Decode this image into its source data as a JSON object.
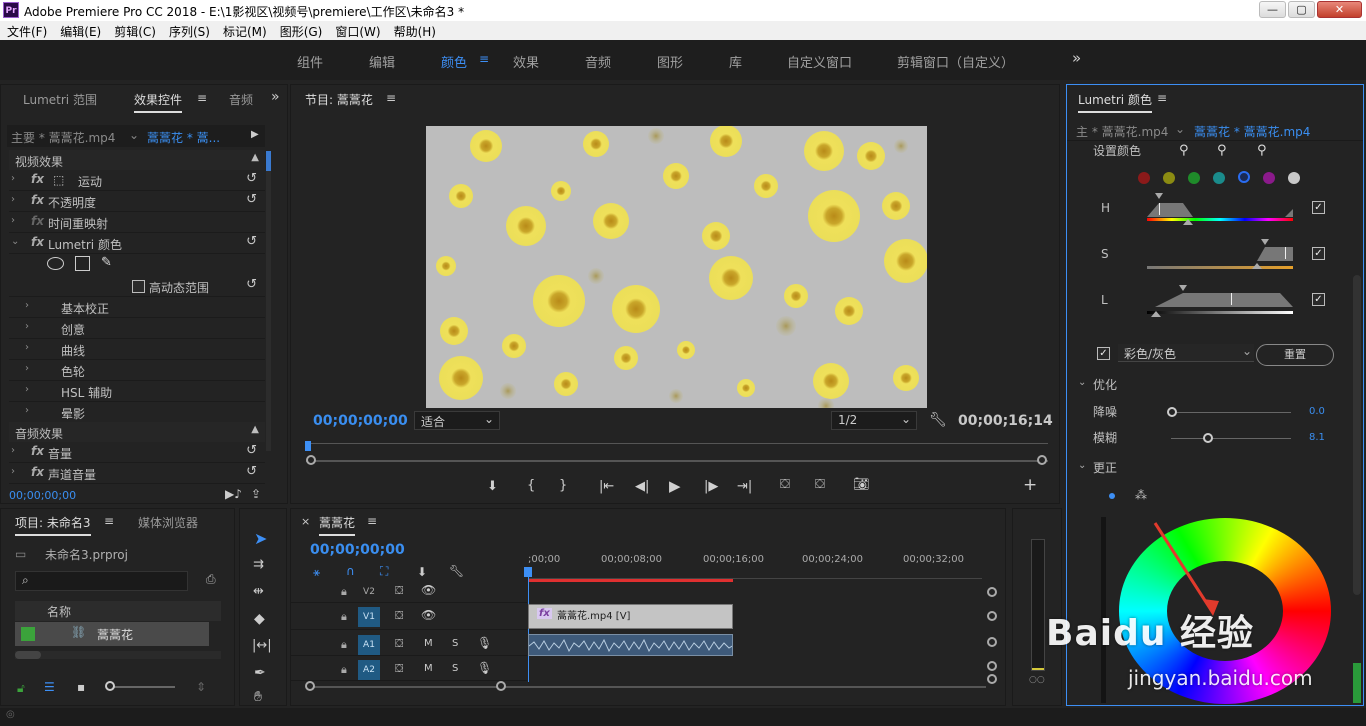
{
  "titlebar": {
    "logo": "Pr",
    "title": "Adobe Premiere Pro CC 2018 - E:\\1影视区\\视频号\\premiere\\工作区\\未命名3 *",
    "min": "—",
    "max": "▢",
    "close": "✕"
  },
  "menu": [
    "文件(F)",
    "编辑(E)",
    "剪辑(C)",
    "序列(S)",
    "标记(M)",
    "图形(G)",
    "窗口(W)",
    "帮助(H)"
  ],
  "workspaces": [
    "组件",
    "编辑",
    "颜色",
    "效果",
    "音频",
    "图形",
    "库",
    "自定义窗口",
    "剪辑窗口（自定义）"
  ],
  "workspace_active": "颜色",
  "workspace_more": "»",
  "effects_panel": {
    "tabs": [
      "Lumetri 范围",
      "效果控件",
      "音频"
    ],
    "active_tab": "效果控件",
    "master_clip": "主要 * 蒿蒿花.mp4",
    "seq_clip": "蒿蒿花 * 蒿...",
    "video_section": "视频效果",
    "effects": [
      "运动",
      "不透明度",
      "时间重映射",
      "Lumetri 颜色"
    ],
    "hdr_label": "高动态范围",
    "lumetri_sub": [
      "基本校正",
      "创意",
      "曲线",
      "色轮",
      "HSL 辅助",
      "晕影"
    ],
    "audio_section": "音频效果",
    "audio_effects": [
      "音量",
      "声道音量"
    ],
    "timecode": "00;00;00;00"
  },
  "program": {
    "title": "节目: 蒿蒿花",
    "timecode_left": "00;00;00;00",
    "fit": "适合",
    "resolution": "1/2",
    "timecode_right": "00;00;16;14"
  },
  "project": {
    "tabs": [
      "项目: 未命名3",
      "媒体浏览器"
    ],
    "file": "未命名3.prproj",
    "search_placeholder": "",
    "col_name": "名称",
    "item": "蒿蒿花"
  },
  "timeline": {
    "title": "蒿蒿花",
    "timecode": "00;00;00;00",
    "ruler": [
      ";00;00",
      "00;00;08;00",
      "00;00;16;00",
      "00;00;24;00",
      "00;00;32;00"
    ],
    "tracks": [
      "V2",
      "V1",
      "A1",
      "A2"
    ],
    "clip_label": "蒿蒿花.mp4 [V]",
    "m": "M",
    "s": "S"
  },
  "lumetri": {
    "title": "Lumetri 颜色",
    "master": "主 * 蒿蒿花.mp4",
    "seq": "蒿蒿花 * 蒿蒿花.mp4",
    "set_color": "设置颜色",
    "swatches": [
      "#8b1a1a",
      "#8b8b12",
      "#1f8b2a",
      "#1a8b8b",
      "#2a6cf0",
      "#8b1a8b",
      "#c8c8c8"
    ],
    "h": "H",
    "s": "S",
    "l": "L",
    "mode": "彩色/灰色",
    "reset": "重置",
    "optimize": "优化",
    "denoise": "降噪",
    "denoise_val": "0.0",
    "blur": "模糊",
    "blur_val": "8.1",
    "correct": "更正"
  },
  "watermark": {
    "brand": "Baidu 经验",
    "url": "jingyan.baidu.com"
  }
}
